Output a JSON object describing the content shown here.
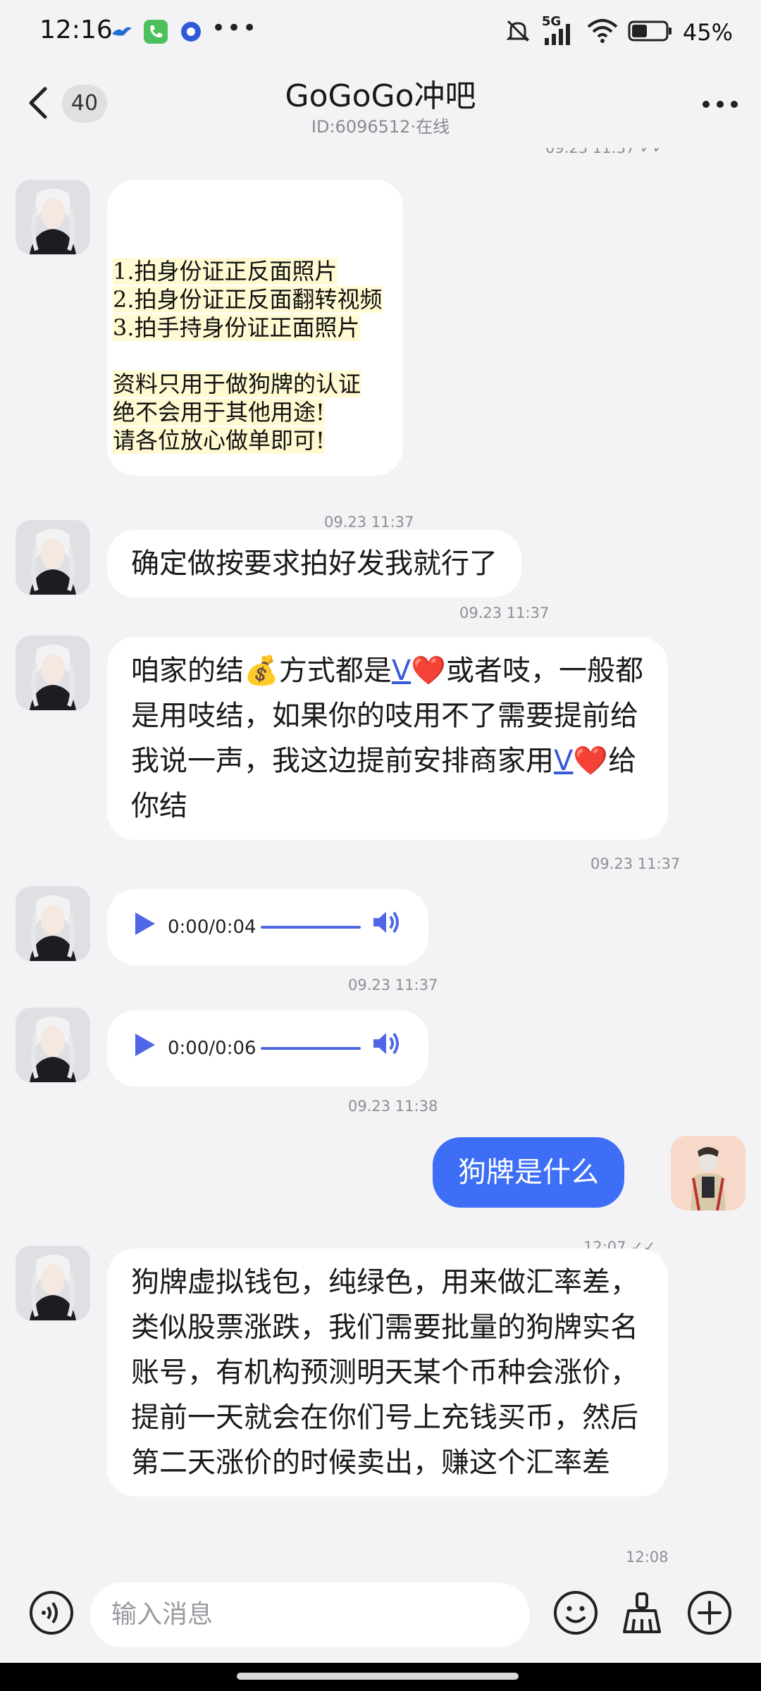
{
  "status_bar": {
    "time": "12:16",
    "dots": "•••",
    "network": "5G",
    "battery_percent": "45%",
    "battery_level": 0.45
  },
  "header": {
    "unread_count": "40",
    "title": "GoGoGo冲吧",
    "subtitle": "ID:6096512·在线",
    "top_partial_ts": "09.23 11:37"
  },
  "messages": [
    {
      "id": "m1",
      "lines": [
        "1.拍身份证正反面照片",
        "2.拍身份证正反面翻转视频",
        "3.拍手持身份证正面照片",
        "",
        "资料只用于做狗牌的认证",
        "绝不会用于其他用途!",
        "请各位放心做单即可!"
      ],
      "timestamp": "09.23 11:37"
    },
    {
      "id": "m2",
      "text": "确定做按要求拍好发我就行了",
      "timestamp": "09.23 11:37"
    },
    {
      "id": "m3",
      "part1": "咱家的结",
      "emoji_money": "💰",
      "part2": "方式都是",
      "link1": "V",
      "heart": "❤️",
      "part3": "或者吱，一般都是用吱结，如果你的吱用不了需要提前给我说一声，我这边提前安排商家用",
      "link2": "V",
      "part4": "给你结",
      "timestamp": "09.23 11:37"
    },
    {
      "id": "m4",
      "audio_time": "0:00/0:04",
      "timestamp": "09.23 11:37"
    },
    {
      "id": "m5",
      "audio_time": "0:00/0:06",
      "timestamp": "09.23 11:38"
    },
    {
      "id": "m6",
      "text": "狗牌是什么",
      "timestamp": "12:07"
    },
    {
      "id": "m7",
      "text": "狗牌虚拟钱包，纯绿色，用来做汇率差，类似股票涨跌，我们需要批量的狗牌实名账号，有机构预测明天某个币种会涨价，提前一天就会在你们号上充钱买币，然后第二天涨价的时候卖出，赚这个汇率差",
      "timestamp": "12:08"
    }
  ],
  "input_bar": {
    "placeholder": "输入消息"
  },
  "colors": {
    "accent": "#3d6ef5",
    "background": "#f3f3f5",
    "bubble": "#ffffff"
  }
}
